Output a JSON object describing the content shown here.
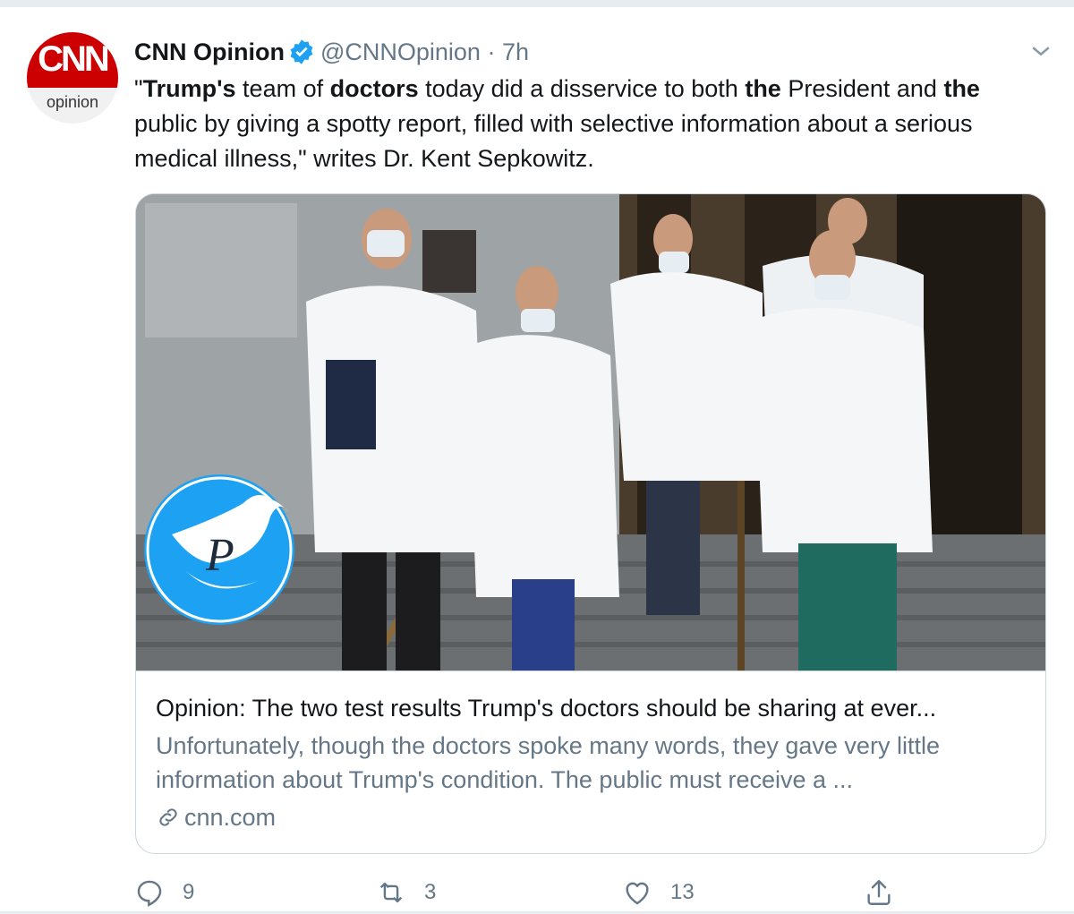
{
  "author": {
    "avatar_logo": "CNN",
    "avatar_subtitle": "opinion",
    "name": "CNN Opinion",
    "handle": "@CNNOpinion",
    "separator": "·",
    "time": "7h"
  },
  "tweet_text": {
    "p1": "\"",
    "b1": "Trump's",
    "p2": " team of ",
    "b2": "doctors",
    "p3": " today did a disservice to both ",
    "b3": "the",
    "p4": " President and ",
    "b4": "the",
    "p5": " public by giving a spotty report, filled with selective information about a serious medical illness,\" writes Dr. Kent Sepkowitz."
  },
  "card": {
    "title": "Opinion: The two test results Trump's doctors should be sharing at ever...",
    "description": "Unfortunately, though the doctors spoke many words, they gave very little information about Trump's condition. The public must receive a ...",
    "domain": "cnn.com"
  },
  "actions": {
    "reply_count": "9",
    "retweet_count": "3",
    "like_count": "13"
  },
  "icons": {
    "verified": "verified-badge-icon",
    "caret": "chevron-down-icon",
    "link": "link-icon",
    "reply": "reply-icon",
    "retweet": "retweet-icon",
    "like": "heart-icon",
    "share": "share-icon",
    "watermark": "twitter-bird-watermark"
  },
  "colors": {
    "brand_blue": "#1da1f2",
    "cnn_red": "#cc0000",
    "text_primary": "#14171a",
    "text_secondary": "#657786"
  }
}
